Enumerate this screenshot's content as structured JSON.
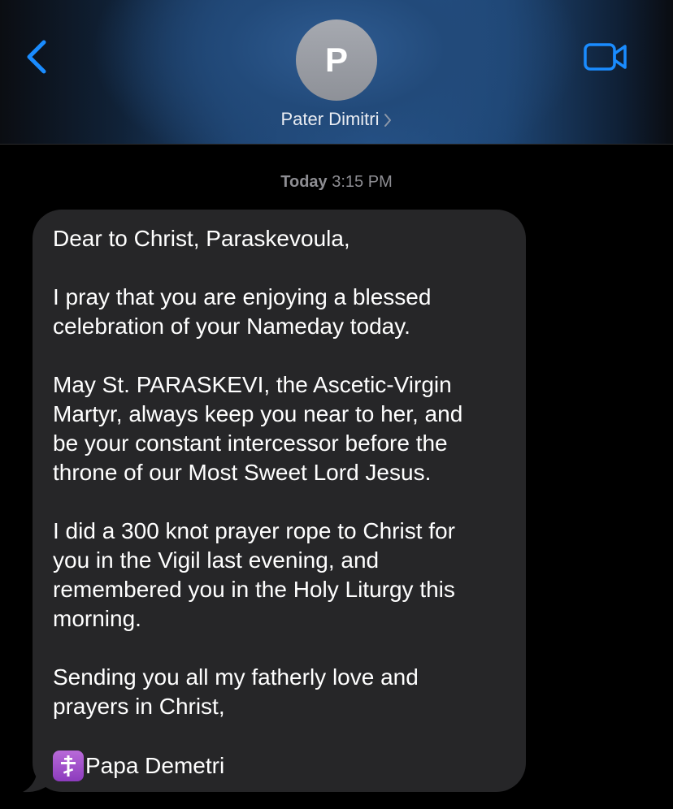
{
  "header": {
    "back_icon": "chevron-left-icon",
    "avatar_initial": "P",
    "contact_name": "Pater Dimitri",
    "contact_chevron_icon": "chevron-right-icon",
    "video_icon": "video-camera-icon",
    "accent_color": "#1a8cff"
  },
  "conversation": {
    "timestamp_day": "Today",
    "timestamp_time": "3:15 PM",
    "message": {
      "paragraphs": [
        [
          "Dear to Christ, Paraskevoula,"
        ],
        [
          "I pray that you are enjoying a blessed",
          "celebration of your Nameday today."
        ],
        [
          "May St. PARASKEVI, the Ascetic-Virgin",
          "Martyr, always keep you near to her, and",
          "be your constant intercessor before the",
          "throne of our Most Sweet Lord Jesus."
        ],
        [
          "I did a 300 knot prayer rope to Christ for",
          "you in the Vigil last evening, and",
          "remembered you in the Holy Liturgy this",
          "morning."
        ],
        [
          "Sending you all my fatherly love and",
          "prayers in Christ,"
        ]
      ],
      "signature_emoji": "orthodox-cross-icon",
      "signature": "Papa Demetri",
      "bubble_color": "#262628"
    }
  }
}
